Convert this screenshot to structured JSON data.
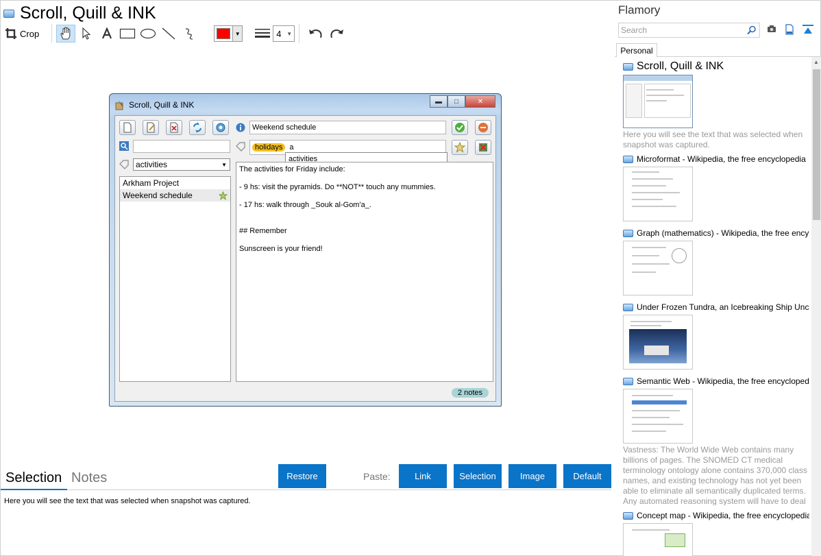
{
  "app": {
    "title": "Scroll, Quill & INK"
  },
  "toolbar": {
    "crop_label": "Crop",
    "line_width": "4",
    "stroke_color": "#ff0000",
    "tools": [
      "hand-icon",
      "pointer-icon",
      "text-icon",
      "rectangle-icon",
      "ellipse-icon",
      "line-icon",
      "freehand-icon"
    ]
  },
  "snapshot": {
    "window_title": "Scroll, Quill & INK",
    "note_title": "Weekend schedule",
    "tag_chip": "holidays",
    "tag_input": "a",
    "autocomplete": "activities",
    "filter_select": "activities",
    "notes": [
      "Arkham Project",
      "Weekend schedule"
    ],
    "editor_lines": [
      "The activities for Friday include:",
      "- 9 hs: visit the pyramids. Do **NOT** touch any mummies.",
      "- 17 hs: walk through _Souk al-Gom'a_.",
      "## Remember",
      "Sunscreen is your friend!"
    ],
    "notes_count": "2 notes"
  },
  "bottom": {
    "tabs": [
      "Selection",
      "Notes"
    ],
    "restore_label": "Restore",
    "paste_label": "Paste:",
    "paste_buttons": [
      "Link",
      "Selection",
      "Image",
      "Default"
    ],
    "selection_text": "Here you will see the text that was selected when snapshot was captured.",
    "accent_color": "#0a74c9"
  },
  "sidebar": {
    "title": "Flamory",
    "search_placeholder": "Search",
    "tab": "Personal",
    "items": [
      {
        "title": "Scroll, Quill & INK",
        "desc": "Here you will see the text that was selected when snapshot was captured."
      },
      {
        "title": "Microformat - Wikipedia, the free encyclopedia"
      },
      {
        "title": "Graph (mathematics) - Wikipedia, the free ency"
      },
      {
        "title": "Under Frozen Tundra, an Icebreaking Ship Unco"
      },
      {
        "title": "Semantic Web - Wikipedia, the free encycloped",
        "desc": "Vastness: The World Wide Web contains many billions of pages. The SNOMED CT medical terminology ontology alone contains 370,000 class names, and existing technology has not yet been able to eliminate all semantically duplicated terms. Any automated reasoning system will have to deal with truly huge inputs."
      },
      {
        "title": "Concept map - Wikipedia, the free encyclopedia"
      }
    ]
  }
}
